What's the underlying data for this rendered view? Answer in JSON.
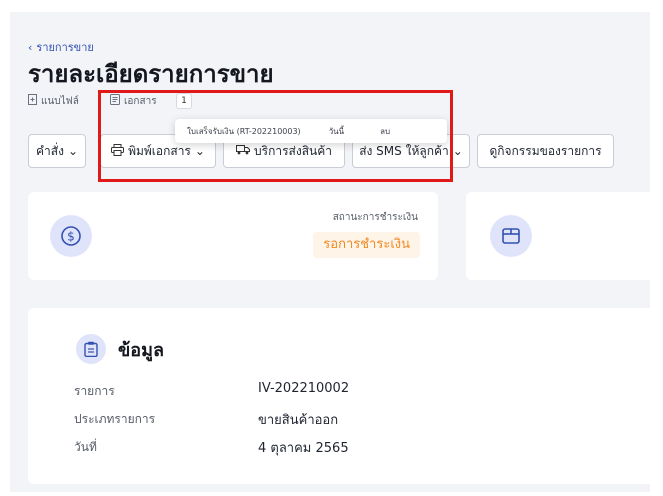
{
  "header": {
    "breadcrumb": "รายการขาย",
    "page_title": "รายละเอียดรายการขาย"
  },
  "tabs": [
    {
      "label": "แนบไฟล์",
      "icon": "attachment-icon"
    },
    {
      "label": "เอกสาร",
      "icon": "document-icon",
      "count": "1"
    }
  ],
  "documents_popup": {
    "doc_name": "ใบเสร็จรับเงิน (RT-202210003)",
    "date_label": "วันนี้",
    "delete_label": "ลบ"
  },
  "toolbar": {
    "command_label": "คำสั่ง",
    "print_label": "พิมพ์เอกสาร",
    "shipping_label": "บริการส่งสินค้า",
    "sms_label": "ส่ง SMS ให้ลูกค้า",
    "activity_label": "ดูกิจกรรมของรายการ"
  },
  "payment_card": {
    "status_label": "สถานะการชำระเงิน",
    "status_value": "รอการชำระเงิน",
    "icon": "dollar-coin-icon"
  },
  "shipping_card": {
    "icon": "box-icon"
  },
  "info": {
    "title": "ข้อมูล",
    "icon": "clipboard-icon",
    "rows": [
      {
        "label": "รายการ",
        "value": "IV-202210002"
      },
      {
        "label": "ประเภทรายการ",
        "value": "ขายสินค้าออก"
      },
      {
        "label": "วันที่",
        "value": "4 ตุลาคม 2565"
      }
    ]
  },
  "colors": {
    "accent": "#3451b2",
    "pending_text": "#f08a24",
    "pending_bg": "#fff4e8",
    "highlight_border": "#e01a1a",
    "icon_circle": "#dfe4fb"
  }
}
